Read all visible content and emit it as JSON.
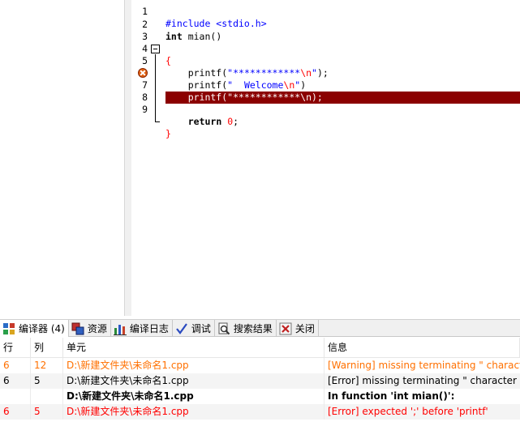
{
  "editor": {
    "lines": [
      {
        "num": "1",
        "tokens": [
          {
            "text": "#include <stdio.h>",
            "cls": "s"
          }
        ]
      },
      {
        "num": "2",
        "tokens": [
          {
            "text": "int",
            "cls": "k"
          },
          {
            "text": " mian()",
            "cls": ""
          }
        ]
      },
      {
        "num": "3",
        "tokens": [
          {
            "text": "{",
            "cls": "br"
          }
        ]
      },
      {
        "num": "4",
        "tokens": [
          {
            "text": "    printf(",
            "cls": ""
          },
          {
            "text": "\"************",
            "cls": "s"
          },
          {
            "text": "\\n",
            "cls": "n"
          },
          {
            "text": "\"",
            "cls": "s"
          },
          {
            "text": ");",
            "cls": ""
          }
        ]
      },
      {
        "num": "5",
        "tokens": [
          {
            "text": "    printf(",
            "cls": ""
          },
          {
            "text": "\"  Welcome",
            "cls": "s"
          },
          {
            "text": "\\n",
            "cls": "n"
          },
          {
            "text": "\"",
            "cls": "s"
          },
          {
            "text": ")",
            "cls": ""
          }
        ]
      },
      {
        "num": "",
        "tokens": [
          {
            "text": "    printf(\"************\\n);",
            "cls": ""
          }
        ]
      },
      {
        "num": "7",
        "tokens": []
      },
      {
        "num": "8",
        "tokens": [
          {
            "text": "    ",
            "cls": ""
          },
          {
            "text": "return",
            "cls": "k"
          },
          {
            "text": " ",
            "cls": ""
          },
          {
            "text": "0",
            "cls": "n"
          },
          {
            "text": ";",
            "cls": ""
          }
        ]
      },
      {
        "num": "9",
        "tokens": [
          {
            "text": "}",
            "cls": "br"
          }
        ]
      }
    ]
  },
  "tabs": [
    {
      "label": "编译器 (4)",
      "icon": "grid-icon"
    },
    {
      "label": "资源",
      "icon": "resources-icon"
    },
    {
      "label": "编译日志",
      "icon": "bar-chart-icon"
    },
    {
      "label": "调试",
      "icon": "checkmark-icon"
    },
    {
      "label": "搜索结果",
      "icon": "search-icon"
    },
    {
      "label": "关闭",
      "icon": "close-icon"
    }
  ],
  "table": {
    "headers": [
      "行",
      "列",
      "单元",
      "信息"
    ],
    "rows": [
      {
        "line": "6",
        "col": "12",
        "unit": "D:\\新建文件夹\\未命名1.cpp",
        "info": "[Warning] missing terminating \" character",
        "kind": "warn"
      },
      {
        "line": "6",
        "col": "5",
        "unit": "D:\\新建文件夹\\未命名1.cpp",
        "info": "[Error] missing terminating \" character",
        "kind": "normal"
      },
      {
        "line": "",
        "col": "",
        "unit": "D:\\新建文件夹\\未命名1.cpp",
        "info": "In function 'int mian()':",
        "kind": "bold"
      },
      {
        "line": "6",
        "col": "5",
        "unit": "D:\\新建文件夹\\未命名1.cpp",
        "info": "[Error] expected ';' before 'printf'",
        "kind": "err"
      }
    ]
  },
  "colors": {
    "highlight_line": "#8b0000",
    "warning_text": "#ff7000",
    "error_text": "#ff0000",
    "string_text": "#0000ff"
  }
}
